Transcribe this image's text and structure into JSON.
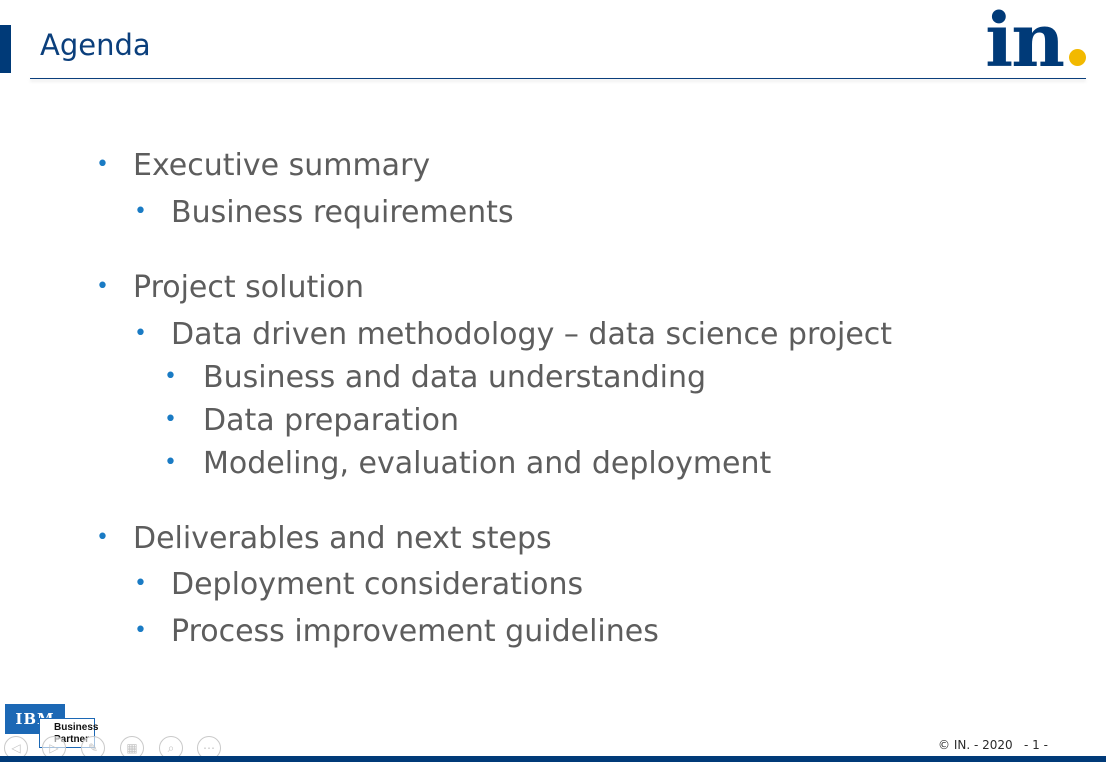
{
  "slide": {
    "title": "Agenda",
    "brand_logo_text": "in",
    "colors": {
      "primary_blue": "#003a78",
      "bullet_blue": "#1a7bc4",
      "logo_dot_yellow": "#f2b900",
      "body_text_gray": "#5d5d5d"
    }
  },
  "agenda": {
    "items": [
      {
        "label": "Executive summary",
        "level": 1
      },
      {
        "label": "Business requirements",
        "level": 2
      },
      {
        "label": "Project solution",
        "level": 1
      },
      {
        "label": "Data driven methodology – data science project",
        "level": 2
      },
      {
        "label": "Business and data understanding",
        "level": 3
      },
      {
        "label": "Data preparation",
        "level": 3
      },
      {
        "label": "Modeling, evaluation and deployment",
        "level": 3
      },
      {
        "label": "Deliverables and next steps",
        "level": 1
      },
      {
        "label": "Deployment considerations",
        "level": 2
      },
      {
        "label": "Process improvement guidelines",
        "level": 2
      }
    ],
    "bullet_glyph": "•"
  },
  "ibm_badge": {
    "ibm_text": "IBM",
    "partner_line1": "Business",
    "partner_line2": "Partner"
  },
  "nav": {
    "prev_icon": "◁",
    "next_icon": "▷",
    "pen_icon": "✎",
    "slides_icon": "▦",
    "zoom_icon": "⌕",
    "more_icon": "⋯"
  },
  "footer": {
    "copyright": "© IN. - 2020",
    "page_number": "- 1 -"
  }
}
